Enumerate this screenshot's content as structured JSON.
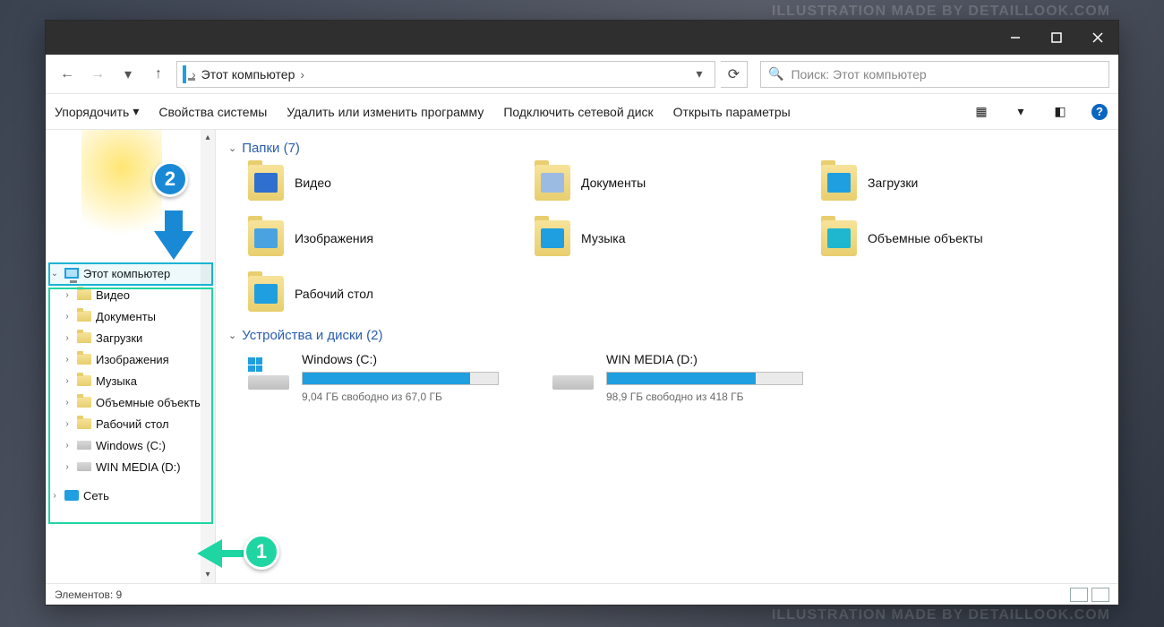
{
  "watermark": "ILLUSTRATION MADE BY DETAILLOOK.COM",
  "breadcrumb": {
    "root": "Этот компьютер"
  },
  "search": {
    "placeholder": "Поиск: Этот компьютер"
  },
  "toolbar": {
    "organize": "Упорядочить",
    "systemProps": "Свойства системы",
    "uninstall": "Удалить или изменить программу",
    "mapDrive": "Подключить сетевой диск",
    "openSettings": "Открыть параметры"
  },
  "tree": {
    "thisPc": "Этот компьютер",
    "children": [
      "Видео",
      "Документы",
      "Загрузки",
      "Изображения",
      "Музыка",
      "Объемные объекты",
      "Рабочий стол",
      "Windows (C:)",
      "WIN MEDIA (D:)"
    ],
    "network": "Сеть"
  },
  "groups": {
    "foldersHeader": "Папки (7)",
    "disksHeader": "Устройства и диски (2)"
  },
  "folders": [
    {
      "name": "Видео",
      "badge": "#2f6fd0"
    },
    {
      "name": "Документы",
      "badge": "#9bbbe3"
    },
    {
      "name": "Загрузки",
      "badge": "#1f9fe0"
    },
    {
      "name": "Изображения",
      "badge": "#4aa3e0"
    },
    {
      "name": "Музыка",
      "badge": "#1f9fe0"
    },
    {
      "name": "Объемные объекты",
      "badge": "#1fb6d0"
    },
    {
      "name": "Рабочий стол",
      "badge": "#1f9fe0"
    }
  ],
  "disks": [
    {
      "name": "Windows (C:)",
      "free": "9,04 ГБ свободно из 67,0 ГБ",
      "fillPct": 86,
      "winlogo": true
    },
    {
      "name": "WIN MEDIA (D:)",
      "free": "98,9 ГБ свободно из 418 ГБ",
      "fillPct": 76,
      "winlogo": false
    }
  ],
  "status": {
    "items": "Элементов: 9"
  },
  "callouts": {
    "one": "1",
    "two": "2"
  }
}
